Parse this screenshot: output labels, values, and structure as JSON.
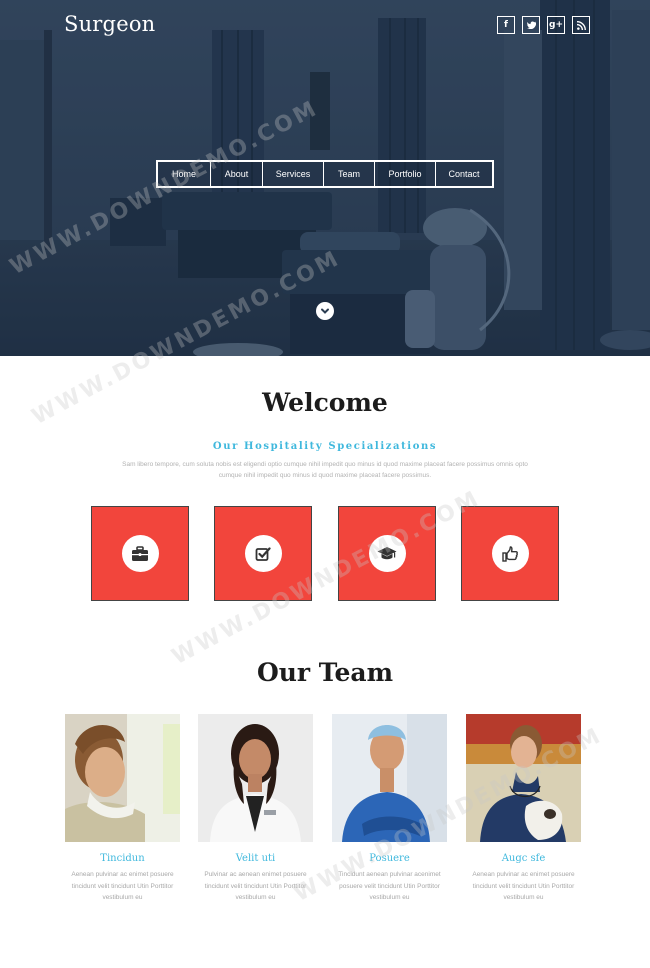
{
  "brand": "Surgeon",
  "social": [
    {
      "icon": "facebook-icon",
      "glyph": "f"
    },
    {
      "icon": "twitter-icon",
      "glyph": "t"
    },
    {
      "icon": "google-plus-icon",
      "glyph": "g+"
    },
    {
      "icon": "rss-icon",
      "glyph": "ɹ"
    }
  ],
  "nav": [
    "Home",
    "About",
    "Services",
    "Team",
    "Portfolio",
    "Contact"
  ],
  "welcome": {
    "title": "Welcome",
    "subtitle": "Our Hospitality Specializations",
    "description": "Sam libero tempore, cum soluta nobis est eligendi optio cumque nihil impedit quo minus id quod maxime placeat facere possimus omnis opto cumque nihil impedit quo minus id quod maxime placeat facere possimus."
  },
  "features": [
    {
      "icon": "briefcase-icon"
    },
    {
      "icon": "checkbox-icon"
    },
    {
      "icon": "graduation-cap-icon"
    },
    {
      "icon": "thumbs-up-icon"
    }
  ],
  "team": {
    "title": "Our Team",
    "members": [
      {
        "name": "Tincidun",
        "description": "Aenean pulvinar ac enimet posuere tincidunt velit tincidunt Utin Porttitor vestibulum eu"
      },
      {
        "name": "Velit uti",
        "description": "Pulvinar ac aenean enimet posuere tincidunt velit tincidunt Utin Porttitor vestibulum eu"
      },
      {
        "name": "Posuere",
        "description": "Tincidunt aenean pulvinar acenimet posuere velit tincidunt Utin Porttitor vestibulum eu"
      },
      {
        "name": "Augc sfe",
        "description": "Aenean pulvinar ac enimet posuere tincidunt velit tincidunt Utin Porttitor vestibulum eu"
      }
    ]
  },
  "watermark": "WWW.DOWNDEMO.COM",
  "colors": {
    "accent": "#3fb8dd",
    "feature_red": "#f2453c",
    "hero_dark": "#2c3d52"
  }
}
